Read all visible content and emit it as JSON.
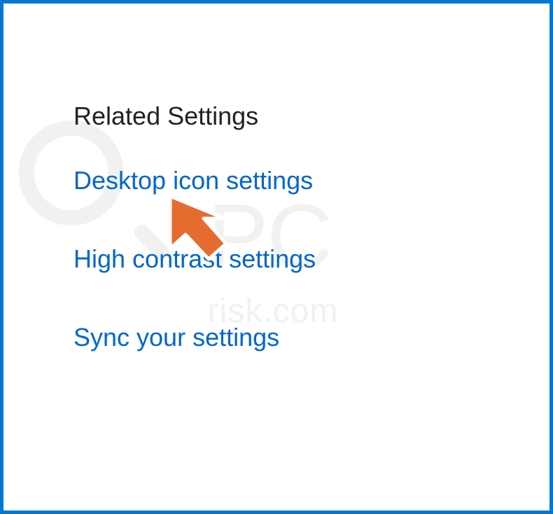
{
  "section": {
    "heading": "Related Settings",
    "links": [
      {
        "label": "Desktop icon settings"
      },
      {
        "label": "High contrast settings"
      },
      {
        "label": "Sync your settings"
      }
    ]
  },
  "watermark": {
    "main": "PC",
    "sub": "risk.com"
  },
  "cursor": {
    "color": "#e66b2e",
    "border": "#ffffff"
  }
}
